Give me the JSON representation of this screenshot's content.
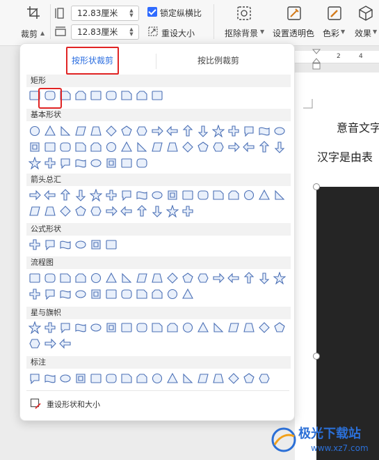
{
  "ribbon": {
    "crop_label": "裁剪",
    "width_value": "12.83厘米",
    "height_value": "12.83厘米",
    "lock_ratio_label": "锁定纵横比",
    "reset_size_label": "重设大小",
    "remove_bg_label": "抠除背景",
    "set_transparent_label": "设置透明色",
    "color_label": "色彩",
    "effects_label": "效果",
    "lock_ratio_checked": true,
    "accent": "#2f6bff"
  },
  "ruler": {
    "ticks": [
      "2",
      "4"
    ]
  },
  "document": {
    "line1": "意音文字",
    "line2": "汉字是由表"
  },
  "crop_panel": {
    "tabs": [
      {
        "label": "按形状裁剪",
        "active": true
      },
      {
        "label": "按比例裁剪",
        "active": false
      }
    ],
    "sections": [
      {
        "title": "矩形",
        "shape_count": 9,
        "selected_index": 1
      },
      {
        "title": "基本形状",
        "shape_count": 42
      },
      {
        "title": "箭头总汇",
        "shape_count": 28
      },
      {
        "title": "公式形状",
        "shape_count": 6
      },
      {
        "title": "流程图",
        "shape_count": 28
      },
      {
        "title": "星与旗帜",
        "shape_count": 20
      },
      {
        "title": "标注",
        "shape_count": 16
      }
    ],
    "footer_label": "重设形状和大小",
    "shape_stroke": "#4a6fb5",
    "shape_fill": "#e9f0fb",
    "highlight": "#e02424",
    "active_tab_color": "#2a6de0"
  },
  "watermark": {
    "text": "极光下载站",
    "url": "www.xz7.com"
  }
}
